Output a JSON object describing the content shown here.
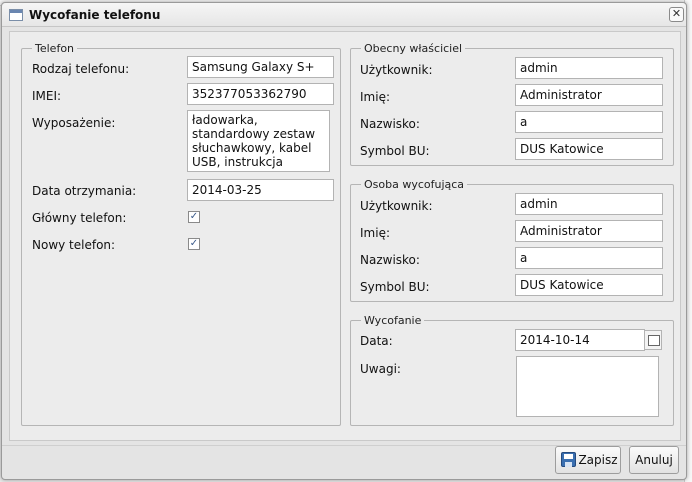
{
  "window": {
    "title": "Wycofanie telefonu",
    "close_glyph": "✕"
  },
  "telefon": {
    "legend": "Telefon",
    "rodzaj_label": "Rodzaj telefonu:",
    "rodzaj_value": "Samsung Galaxy S+",
    "imei_label": "IMEI:",
    "imei_value": "352377053362790",
    "wyposazenie_label": "Wyposażenie:",
    "wyposazenie_value": "ładowarka, standardowy zestaw słuchawkowy, kabel USB, instrukcja",
    "data_label": "Data otrzymania:",
    "data_value": "2014-03-25",
    "glowny_label": "Główny telefon:",
    "glowny_checked": true,
    "nowy_label": "Nowy telefon:",
    "nowy_checked": true
  },
  "obecny": {
    "legend": "Obecny właściciel",
    "uzytkownik_label": "Użytkownik:",
    "uzytkownik_value": "admin",
    "imie_label": "Imię:",
    "imie_value": "Administrator",
    "nazwisko_label": "Nazwisko:",
    "nazwisko_value": "a",
    "bu_label": "Symbol BU:",
    "bu_value": "DUS Katowice"
  },
  "wycofujaca": {
    "legend": "Osoba wycofująca",
    "uzytkownik_label": "Użytkownik:",
    "uzytkownik_value": "admin",
    "imie_label": "Imię:",
    "imie_value": "Administrator",
    "nazwisko_label": "Nazwisko:",
    "nazwisko_value": "a",
    "bu_label": "Symbol BU:",
    "bu_value": "DUS Katowice"
  },
  "wycofanie": {
    "legend": "Wycofanie",
    "data_label": "Data:",
    "data_value": "2014-10-14",
    "uwagi_label": "Uwagi:",
    "uwagi_value": ""
  },
  "buttons": {
    "save": "Zapisz",
    "cancel": "Anuluj"
  },
  "icons": {
    "window": "window-icon",
    "save": "floppy-disk-icon",
    "calendar": "calendar-icon",
    "check": "✓"
  }
}
